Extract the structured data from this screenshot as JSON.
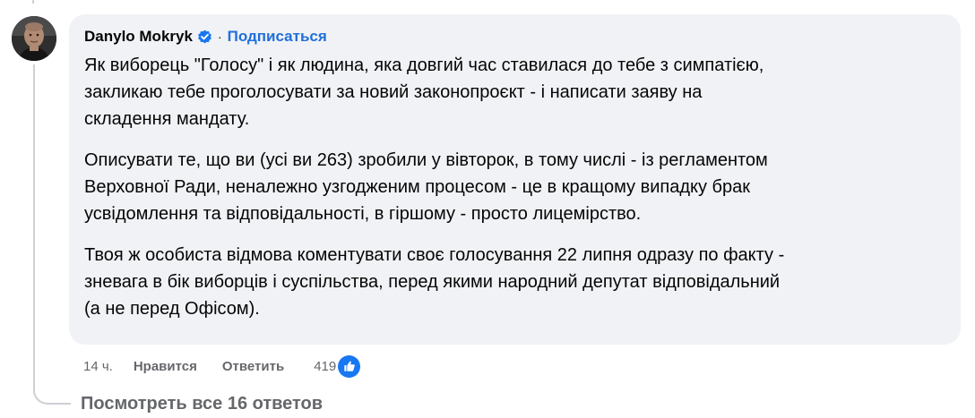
{
  "comment": {
    "author": "Danylo Mokryk",
    "separator": "·",
    "subscribe_label": "Подписаться",
    "paragraphs": [
      "Як виборець \"Голосу\" і як людина, яка довгий час ставилася до тебе з симпатією,\nзакликаю тебе проголосувати за новий законопроєкт - і написати заяву на\nскладення мандату.",
      "Описувати те, що ви (усі ви 263) зробили у вівторок, в тому числі - із регламентом\nВерховної Ради, неналежно узгодженим процесом - це в кращому випадку брак\nусвідомлення та відповідальності, в гіршому - просто лицемірство.",
      "Твоя ж особиста відмова коментувати своє голосування 22 липня одразу по факту -\nзневага в бік виборців і суспільства, перед якими народний депутат відповідальний\n(а не перед Офісом)."
    ],
    "time": "14 ч.",
    "like_label": "Нравится",
    "reply_label": "Ответить",
    "reaction_count": "419"
  },
  "replies_link": "Посмотреть все 16 ответов",
  "icons": {
    "verified": "verified-badge-icon",
    "reaction": "thumbs-up-icon"
  },
  "colors": {
    "bubble": "#f0f2f5",
    "link_blue": "#216fdb",
    "reaction_blue": "#1877f2",
    "secondary_text": "#65676b"
  }
}
